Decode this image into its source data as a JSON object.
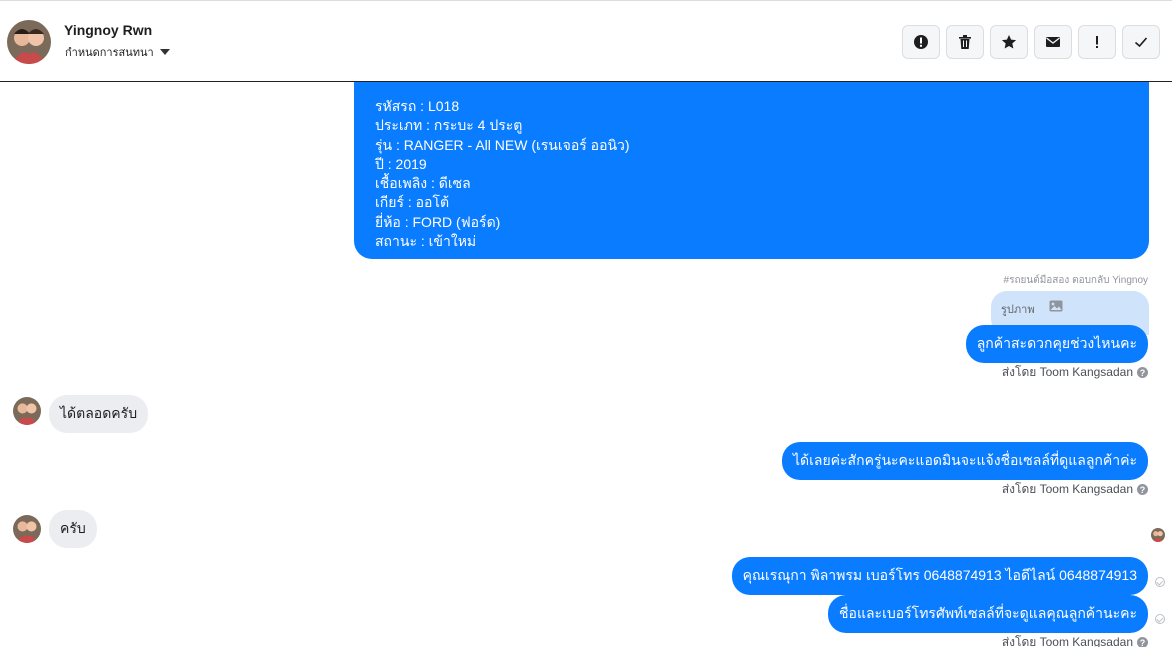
{
  "header": {
    "name": "Yingnoy Rwn",
    "subtitle": "กำหนดการสนทนา",
    "actions": [
      {
        "name": "spam-icon",
        "label": "!"
      },
      {
        "name": "trash-icon",
        "label": "delete"
      },
      {
        "name": "star-icon",
        "label": "star"
      },
      {
        "name": "envelope-icon",
        "label": "mail"
      },
      {
        "name": "exclamation-icon",
        "label": "!"
      },
      {
        "name": "check-icon",
        "label": "done"
      }
    ]
  },
  "car_info": [
    "รหัสรถ : L018",
    "ประเภท : กระบะ 4 ประตู",
    "รุ่น : RANGER - All NEW (เรนเจอร์ ออนิว)",
    "ปี : 2019",
    "เชื้อเพลิง : ดีเซล",
    "เกียร์ : ออโต้",
    "ยี่ห้อ : FORD (ฟอร์ด)",
    "สถานะ : เข้าใหม่"
  ],
  "note": "#รถยนต์มือสอง ตอบกลับ Yingnoy",
  "reply_preview_label": "รูปภาพ",
  "messages": {
    "m1": "ลูกค้าสะดวกคุยช่วงไหนคะ",
    "m2": "ได้ตลอดครับ",
    "m3": "ได้เลยค่ะสักครู่นะคะแอดมินจะแจ้งชื่อเซลล์ที่ดูแลลูกค้าค่ะ",
    "m4": "ครับ",
    "m5": "คุณเรณุกา พิลาพรม        เบอร์โทร 0648874913  ไอดีไลน์ 0648874913",
    "m6": "ชื่อและเบอร์โทรศัพท์เซลล์ที่จะดูแลคุณลูกค้านะคะ"
  },
  "sent_by": "ส่งโดย Toom Kangsadan",
  "help_glyph": "?",
  "colors": {
    "bubble_blue": "#0a7cff",
    "bubble_gray": "#ebedf0",
    "reply_preview": "#cfe3fb"
  }
}
